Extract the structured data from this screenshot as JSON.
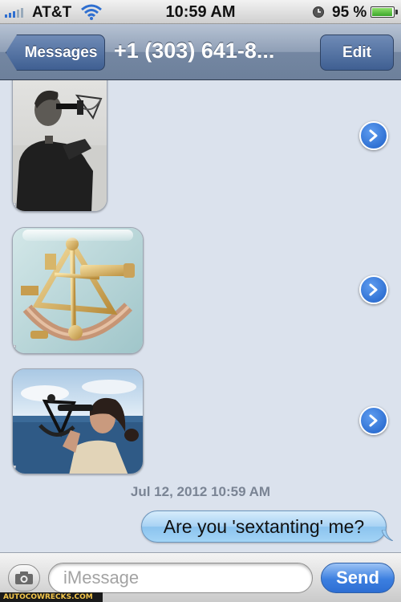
{
  "status_bar": {
    "carrier": "AT&T",
    "time": "10:59 AM",
    "battery_percent": "95 %",
    "battery_level": 0.95,
    "icons": [
      "signal-bars-icon",
      "wifi-icon",
      "alarm-icon",
      "battery-icon"
    ]
  },
  "nav": {
    "back_label": "Messages",
    "title": "+1 (303) 641-8...",
    "edit_label": "Edit"
  },
  "conversation": {
    "received_photos": [
      {
        "subject": "man-with-sextant-photo"
      },
      {
        "subject": "brass-sextant-photo"
      },
      {
        "subject": "woman-with-sextant-photo"
      }
    ],
    "timestamp": "Jul 12, 2012 10:59 AM",
    "sent_message": "Are you 'sextanting' me?"
  },
  "input_bar": {
    "placeholder": "iMessage",
    "value": "",
    "send_label": "Send"
  },
  "watermark": "AUTOCOWRECKS.COM",
  "colors": {
    "nav_bar": "#7487a2",
    "background": "#dbe2ed",
    "sent_bubble": "#a7d2f4",
    "send_button": "#3c7fe0"
  }
}
